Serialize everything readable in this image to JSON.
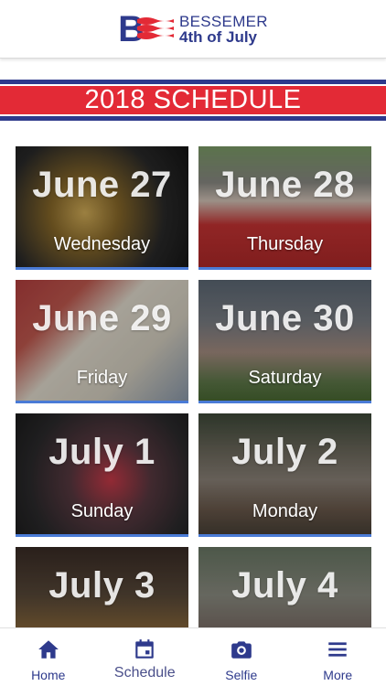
{
  "header": {
    "logo_letter": "B",
    "logo_line1": "BESSEMER",
    "logo_line2": "4th of July"
  },
  "banner": {
    "title": "2018 SCHEDULE"
  },
  "schedule": [
    {
      "date": "June 27",
      "day": "Wednesday"
    },
    {
      "date": "June 28",
      "day": "Thursday"
    },
    {
      "date": "June 29",
      "day": "Friday"
    },
    {
      "date": "June 30",
      "day": "Saturday"
    },
    {
      "date": "July 1",
      "day": "Sunday"
    },
    {
      "date": "July 2",
      "day": "Monday"
    },
    {
      "date": "July 3",
      "day": ""
    },
    {
      "date": "July 4",
      "day": ""
    }
  ],
  "tabbar": {
    "tabs": [
      {
        "label": "Home",
        "icon": "home-icon"
      },
      {
        "label": "Schedule",
        "icon": "calendar-icon"
      },
      {
        "label": "Selfie",
        "icon": "camera-icon"
      },
      {
        "label": "More",
        "icon": "menu-icon"
      }
    ]
  },
  "colors": {
    "brand_blue": "#2e3a8c",
    "brand_red": "#e32a36",
    "card_accent": "#4a7bd6"
  }
}
